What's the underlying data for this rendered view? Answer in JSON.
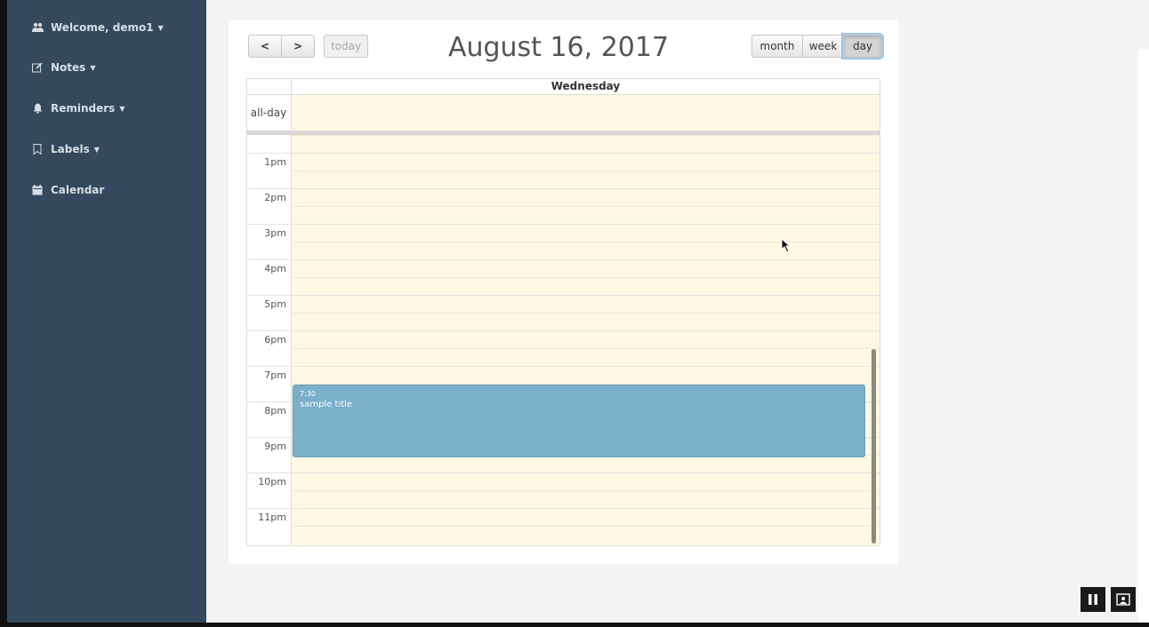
{
  "sidebar": {
    "items": [
      {
        "label": "Welcome, demo1",
        "icon": "users-icon",
        "has_caret": true
      },
      {
        "label": "Notes",
        "icon": "edit-icon",
        "has_caret": true
      },
      {
        "label": "Reminders",
        "icon": "bell-icon",
        "has_caret": true
      },
      {
        "label": "Labels",
        "icon": "bookmark-icon",
        "has_caret": true
      },
      {
        "label": "Calendar",
        "icon": "calendar-icon",
        "has_caret": false
      }
    ],
    "color": "#34495e"
  },
  "calendar": {
    "title": "August 16, 2017",
    "nav": {
      "prev": "<",
      "next": ">",
      "today": "today"
    },
    "views": {
      "month": "month",
      "week": "week",
      "day": "day",
      "active": "day"
    },
    "day_header": "Wednesday",
    "allday_label": "all-day",
    "hours": [
      "1pm",
      "2pm",
      "3pm",
      "4pm",
      "5pm",
      "6pm",
      "7pm",
      "8pm",
      "9pm",
      "10pm",
      "11pm"
    ],
    "event": {
      "time": "7:30",
      "title": "sample title",
      "color": "#7aaec9"
    },
    "today_bg": "#fcf8e3"
  },
  "player_controls": {
    "pause": "pause-icon",
    "screen": "screen-icon"
  }
}
